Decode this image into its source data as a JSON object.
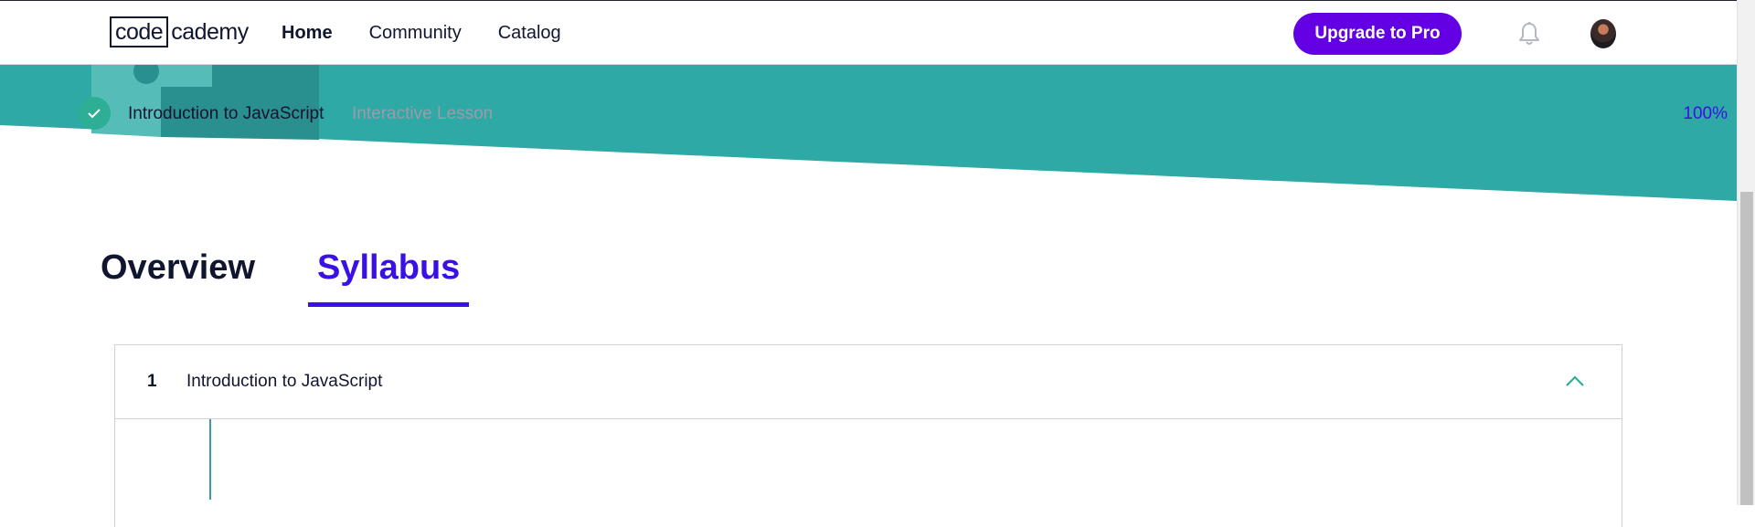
{
  "nav": {
    "logo_boxed": "code",
    "logo_rest": "cademy",
    "links": [
      {
        "label": "Home",
        "active": true
      },
      {
        "label": "Community",
        "active": false
      },
      {
        "label": "Catalog",
        "active": false
      }
    ],
    "upgrade_label": "Upgrade to Pro",
    "icons": [
      "bell-icon",
      "avatar"
    ]
  },
  "colors": {
    "teal": "#2ea9a5",
    "teal_dark": "#29908f",
    "teal_light": "#56bcb7",
    "purple_button": "#6400e4",
    "accent_blue": "#3a10e5",
    "check_green": "#2eae94"
  },
  "tabs": [
    {
      "label": "Overview",
      "selected": false
    },
    {
      "label": "Syllabus",
      "selected": true
    }
  ],
  "module": {
    "number": "1",
    "title": "Introduction to JavaScript",
    "expanded": true,
    "lessons": [
      {
        "title": "Introduction to JavaScript",
        "type": "Interactive Lesson",
        "progress": "100%",
        "completed": true
      }
    ]
  }
}
